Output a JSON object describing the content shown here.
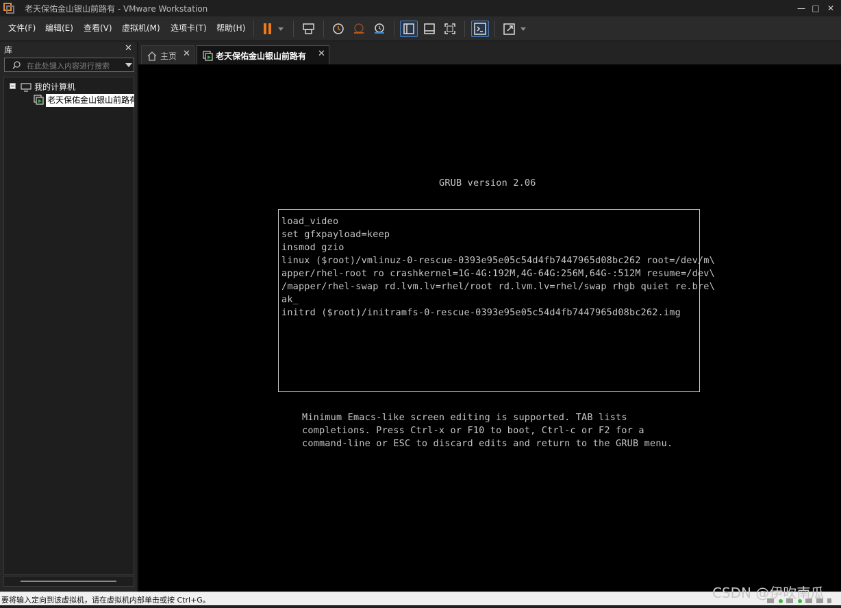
{
  "window": {
    "title": "老天保佑金山银山前路有 - VMware Workstation",
    "controls": [
      "—",
      "□",
      "✕"
    ]
  },
  "menu": {
    "file": "文件(F)",
    "edit": "编辑(E)",
    "view": "查看(V)",
    "vm": "虚拟机(M)",
    "tabs": "选项卡(T)",
    "help": "帮助(H)"
  },
  "library": {
    "header": "库",
    "close": "✕",
    "search_placeholder": "在此处键入内容进行搜索",
    "tree": {
      "root_label": "我的计算机",
      "vm_label": "老天保佑金山银山前路有"
    }
  },
  "tabs": {
    "home_label": "主页",
    "vm_label": "老天保佑金山银山前路有",
    "close": "✕"
  },
  "console": {
    "version": "GRUB version 2.06",
    "edit_lines": [
      "load_video",
      "set gfxpayload=keep",
      "insmod gzio",
      "linux ($root)/vmlinuz-0-rescue-0393e95e05c54d4fb7447965d08bc262 root=/dev/m\\",
      "apper/rhel-root ro crashkernel=1G-4G:192M,4G-64G:256M,64G-:512M resume=/dev\\",
      "/mapper/rhel-swap rd.lvm.lv=rhel/root rd.lvm.lv=rhel/swap rhgb quiet re.bre\\",
      "ak_",
      "initrd ($root)/initramfs-0-rescue-0393e95e05c54d4fb7447965d08bc262.img"
    ],
    "help_lines": [
      "Minimum Emacs-like screen editing is supported. TAB lists",
      "completions. Press Ctrl-x or F10 to boot, Ctrl-c or F2 for a",
      "command-line or ESC to discard edits and return to the GRUB menu."
    ]
  },
  "status": {
    "message": "要将输入定向到该虚拟机，请在虚拟机内部单击或按 Ctrl+G。"
  },
  "watermark": "CSDN @伊吹南瓜",
  "colors": {
    "accent": "#f07a1a",
    "console_text": "#c6c6c6",
    "active_toolbar": "#4a7ebf"
  }
}
